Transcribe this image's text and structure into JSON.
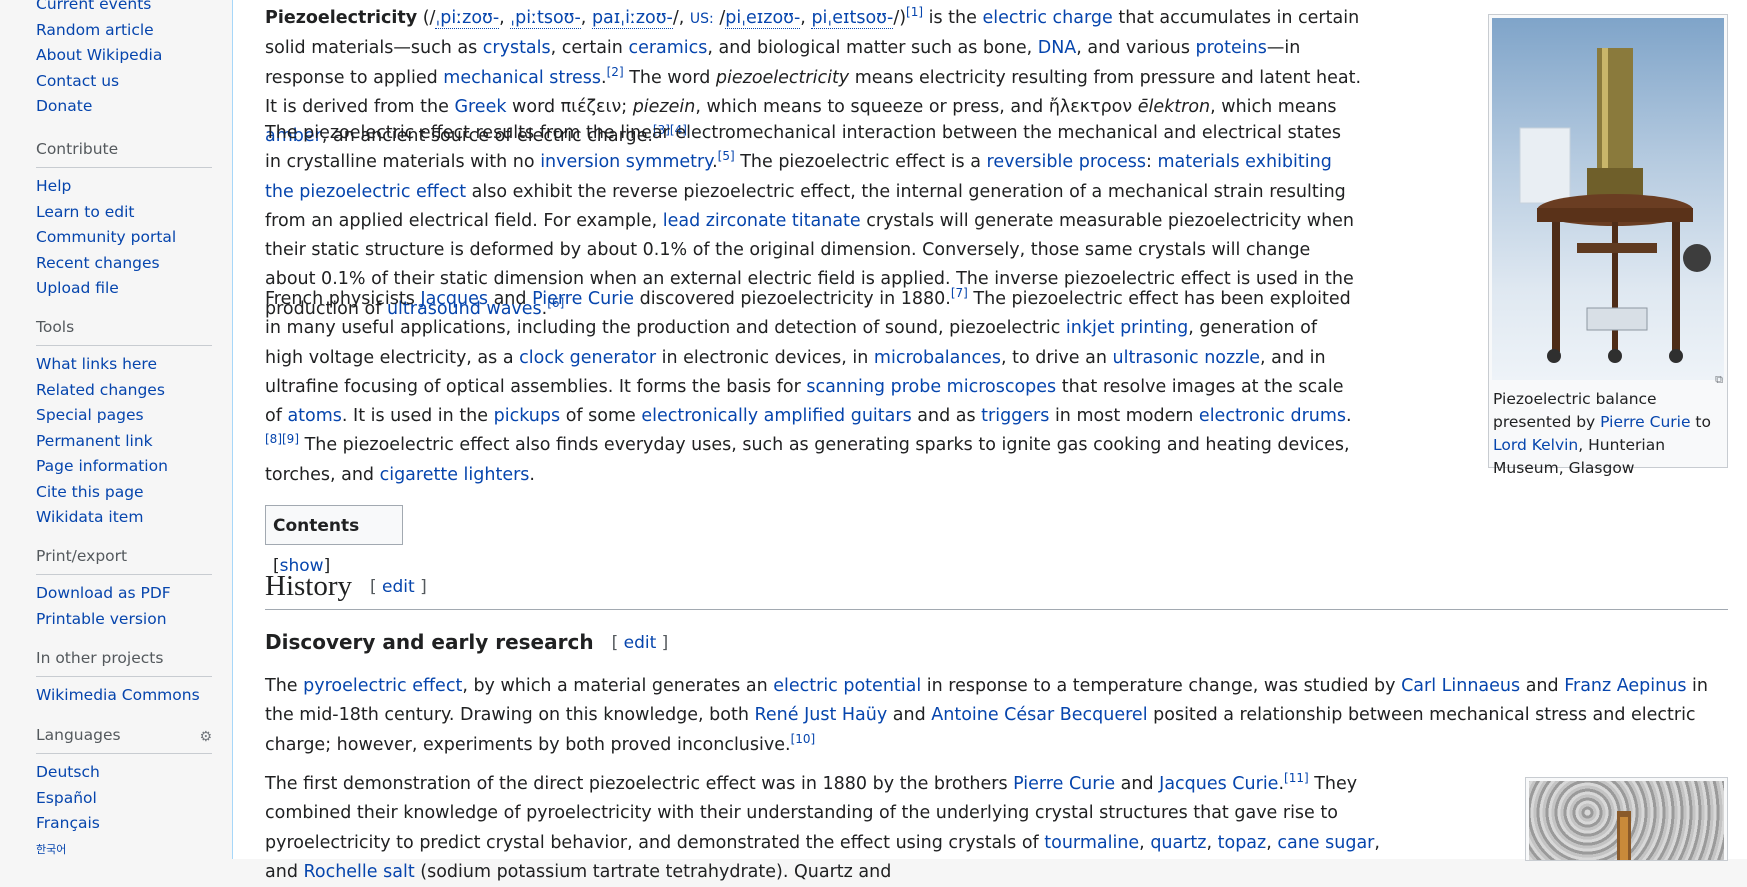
{
  "sidebar": {
    "nav": [
      "Current events",
      "Random article",
      "About Wikipedia",
      "Contact us",
      "Donate"
    ],
    "contribute": {
      "heading": "Contribute",
      "items": [
        "Help",
        "Learn to edit",
        "Community portal",
        "Recent changes",
        "Upload file"
      ]
    },
    "tools": {
      "heading": "Tools",
      "items": [
        "What links here",
        "Related changes",
        "Special pages",
        "Permanent link",
        "Page information",
        "Cite this page",
        "Wikidata item"
      ]
    },
    "print": {
      "heading": "Print/export",
      "items": [
        "Download as PDF",
        "Printable version"
      ]
    },
    "projects": {
      "heading": "In other projects",
      "items": [
        "Wikimedia Commons"
      ]
    },
    "languages": {
      "heading": "Languages",
      "items": [
        "Deutsch",
        "Español",
        "Français",
        "한국어"
      ]
    }
  },
  "article": {
    "p1": {
      "bold": "Piezoelectricity",
      "pron_open": " (/",
      "ipa1": "ˌpiːzoʊ-",
      "sep1": ", ",
      "ipa2": "ˌpiːtsoʊ-",
      "sep2": ", ",
      "ipa3": "paɪˌiːzoʊ-",
      "sep3": "/, ",
      "us": "US:",
      "us_space": " /",
      "ipa4": "piˌeɪzoʊ-",
      "sep4": ", ",
      "ipa5": "piˌeɪtsoʊ-",
      "pron_close": "/)",
      "ref1": "[1]",
      "t1": " is the ",
      "l_charge": "electric charge",
      "t2": " that accumulates in certain solid materials—such as ",
      "l_crystals": "crystals",
      "t3": ", certain ",
      "l_ceramics": "ceramics",
      "t4": ", and biological matter such as bone, ",
      "l_dna": "DNA",
      "t5": ", and various ",
      "l_proteins": "proteins",
      "t6": "—in response to applied ",
      "l_stress": "mechanical stress",
      "t7": ".",
      "ref2": "[2]",
      "t8": " The word ",
      "i_word": "piezoelectricity",
      "t9": " means electricity resulting from pressure and latent heat. It is derived from the ",
      "l_greek": "Greek",
      "t10": " word πιέζειν; ",
      "i_piezein": "piezein",
      "t11": ", which means to squeeze or press, and ἤλεκτρον ",
      "i_elektron": "ēlektron",
      "t12": ", which means ",
      "l_amber": "amber",
      "t13": ", an ancient source of electric charge.",
      "ref3": "[3]",
      "ref4": "[4]"
    },
    "p2": {
      "t1": "The piezoelectric effect results from the linear electromechanical interaction between the mechanical and electrical states in crystalline materials with no ",
      "l_inversion": "inversion symmetry",
      "t2": ".",
      "ref5": "[5]",
      "t3": " The piezoelectric effect is a ",
      "l_reversible": "reversible process",
      "t4": ": ",
      "l_materials": "materials exhibiting the piezoelectric effect",
      "t5": " also exhibit the reverse piezoelectric effect, the internal generation of a mechanical strain resulting from an applied electrical field. For example, ",
      "l_pzt": "lead zirconate titanate",
      "t6": " crystals will generate measurable piezoelectricity when their static structure is deformed by about 0.1% of the original dimension. Conversely, those same crystals will change about 0.1% of their static dimension when an external electric field is applied. The inverse piezoelectric effect is used in the production of ",
      "l_ultrasound": "ultrasound waves",
      "t7": ".",
      "ref6": "[6]"
    },
    "p3": {
      "t1": "French physicists ",
      "l_jacques": "Jacques",
      "t2": " and ",
      "l_pierre": "Pierre Curie",
      "t3": " discovered piezoelectricity in 1880.",
      "ref7": "[7]",
      "t4": " The piezoelectric effect has been exploited in many useful applications, including the production and detection of sound, piezoelectric ",
      "l_inkjet": "inkjet printing",
      "t5": ", generation of high voltage electricity, as a ",
      "l_clock": "clock generator",
      "t6": " in electronic devices, in ",
      "l_micro": "microbalances",
      "t7": ", to drive an ",
      "l_nozzle": "ultrasonic nozzle",
      "t8": ", and in ultrafine focusing of optical assemblies. It forms the basis for ",
      "l_spm": "scanning probe microscopes",
      "t9": " that resolve images at the scale of ",
      "l_atoms": "atoms",
      "t10": ". It is used in the ",
      "l_pickups": "pickups",
      "t11": " of some ",
      "l_guitars": "electronically amplified guitars",
      "t12": " and as ",
      "l_triggers": "triggers",
      "t13": " in most modern ",
      "l_drums": "electronic drums",
      "t14": ".",
      "ref8": "[8]",
      "ref9": "[9]",
      "t15": " The piezoelectric effect also finds everyday uses, such as generating sparks to ignite gas cooking and heating devices, torches, and ",
      "l_lighters": "cigarette lighters",
      "t16": "."
    },
    "infobox": {
      "cap1": "Piezoelectric balance presented by ",
      "cap_l1": "Pierre Curie",
      "cap2": " to ",
      "cap_l2": "Lord Kelvin",
      "cap3": ", Hunterian Museum, Glasgow"
    },
    "toc": {
      "label": "Contents",
      "open": " [",
      "show": "show",
      "close": "]"
    },
    "history": {
      "title": "History",
      "edit_open": "[ ",
      "edit": "edit",
      "edit_close": " ]"
    },
    "discovery": {
      "title": "Discovery and early research",
      "edit_open": "[ ",
      "edit": "edit",
      "edit_close": " ]"
    },
    "p4": {
      "t1": "The ",
      "l_pyro": "pyroelectric effect",
      "t2": ", by which a material generates an ",
      "l_potential": "electric potential",
      "t3": " in response to a temperature change, was studied by ",
      "l_linnaeus": "Carl Linnaeus",
      "t4": " and ",
      "l_aepinus": "Franz Aepinus",
      "t5": " in the mid-18th century. Drawing on this knowledge, both ",
      "l_hauy": "René Just Haüy",
      "t6": " and ",
      "l_becquerel": "Antoine César Becquerel",
      "t7": " posited a relationship between mechanical stress and electric charge; however, experiments by both proved inconclusive.",
      "ref10": "[10]"
    },
    "p5": {
      "t1": "The first demonstration of the direct piezoelectric effect was in 1880 by the brothers ",
      "l_pierre": "Pierre Curie",
      "t2": " and ",
      "l_jacques": "Jacques Curie",
      "t3": ".",
      "ref11": "[11]",
      "t4": " They combined their knowledge of pyroelectricity with their understanding of the underlying crystal structures that gave rise to pyroelectricity to predict crystal behavior, and demonstrated the effect using crystals of ",
      "l_tourmaline": "tourmaline",
      "t5": ", ",
      "l_quartz": "quartz",
      "t6": ", ",
      "l_topaz": "topaz",
      "t7": ", ",
      "l_sugar": "cane sugar",
      "t8": ", and ",
      "l_rochelle": "Rochelle salt",
      "t9": " (sodium potassium tartrate tetrahydrate). Quartz and"
    }
  },
  "colors": {
    "link": "#0645ad",
    "text": "#202122",
    "sidebar_bg": "#f6f6f6"
  }
}
